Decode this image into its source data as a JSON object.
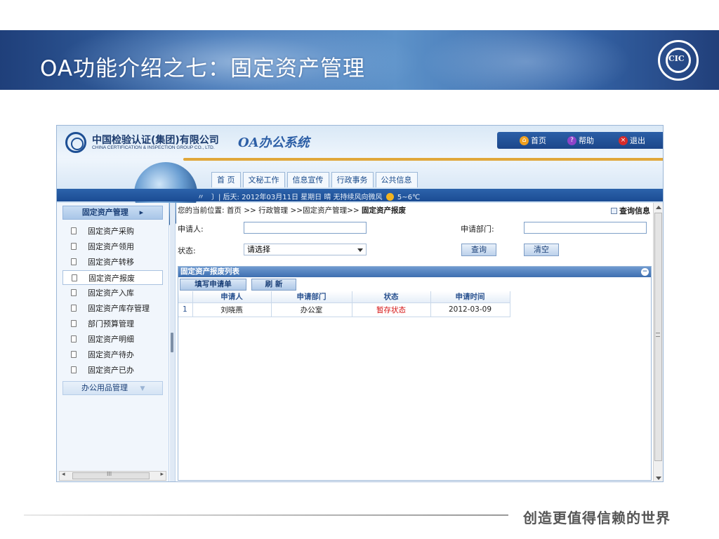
{
  "slide": {
    "title": "OA功能介绍之七：固定资产管理",
    "footer": "创造更值得信赖的世界",
    "logo_text": "CIC"
  },
  "app": {
    "company_name": "中国检验认证(集团)有限公司",
    "company_en": "CHINA CERTIFICATION & INSPECTION GROUP CO., LTD.",
    "oa_title": "OA办公系统",
    "top_links": [
      {
        "label": "首页",
        "icon": "home-icon"
      },
      {
        "label": "帮助",
        "icon": "help-icon"
      },
      {
        "label": "退出",
        "icon": "exit-icon"
      }
    ],
    "nav_tabs": [
      "首 页",
      "文秘工作",
      "信息宣传",
      "行政事务",
      "公共信息"
    ],
    "status_bar": "〃　〕| 后天: 2012年03月11日 星期日 晴 无持续风向微风",
    "temperature": "5~6℃"
  },
  "sidebar": {
    "header": "固定资产管理",
    "items": [
      "固定资产采购",
      "固定资产领用",
      "固定资产转移",
      "固定资产报废",
      "固定资产入库",
      "固定资产库存管理",
      "部门预算管理",
      "固定资产明细",
      "固定资产待办",
      "固定资产已办"
    ],
    "active_index": 3,
    "group2": "办公用品管理",
    "hscroll_label": "III"
  },
  "main": {
    "breadcrumb_prefix": "您的当前位置:  首页 >> 行政管理 >>固定资产管理>> ",
    "breadcrumb_current": "固定资产报废",
    "query_info": "查询信息",
    "form": {
      "applicant_label": "申请人:",
      "applicant_value": "",
      "dept_label": "申请部门:",
      "dept_value": "",
      "status_label": "状态:",
      "status_selected": "请选择",
      "query_button": "查询",
      "clear_button": "清空"
    },
    "list": {
      "title": "固定资产报废列表",
      "new_button": "填写申请单",
      "refresh_button": "刷 新",
      "columns": [
        "申请人",
        "申请部门",
        "状态",
        "申请时间"
      ],
      "rows": [
        {
          "num": "1",
          "applicant": "刘晓燕",
          "dept": "办公室",
          "status": "暂存状态",
          "date": "2012-03-09"
        }
      ]
    }
  },
  "colors": {
    "banner": "#3c6fb0",
    "app_blue": "#1c468a",
    "status_red": "#d61515",
    "gold": "#e0a73a"
  }
}
